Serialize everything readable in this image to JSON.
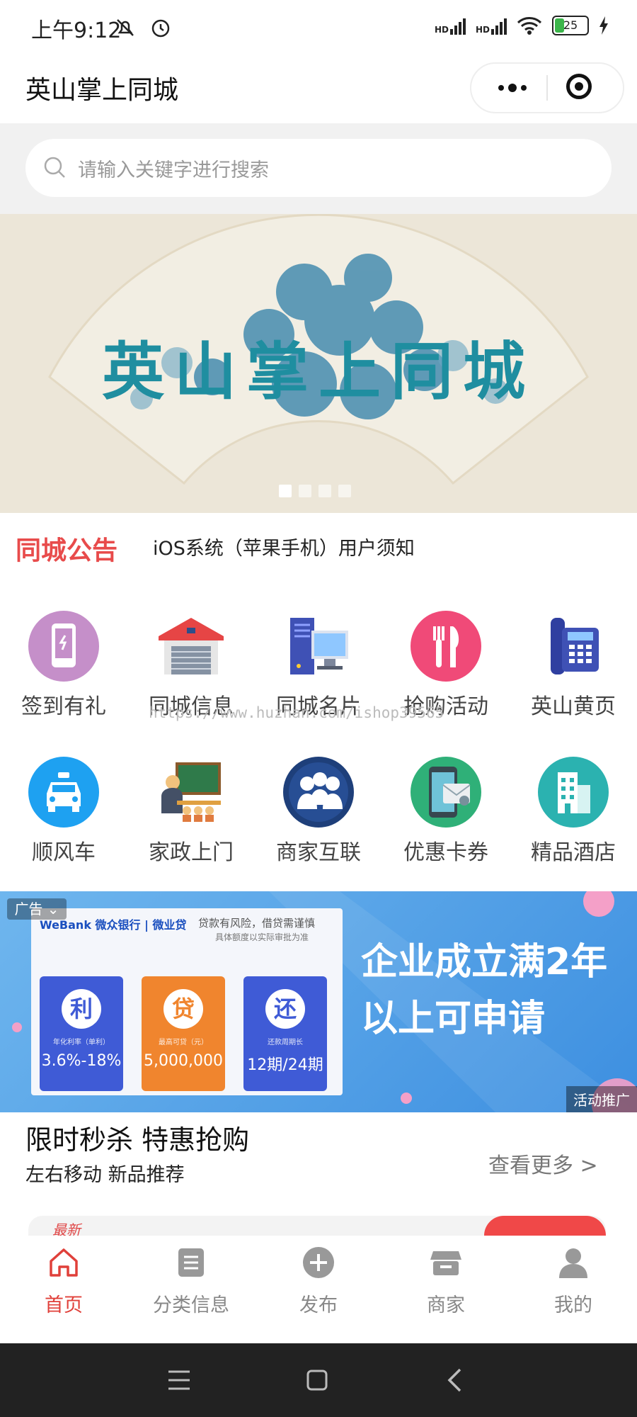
{
  "status_bar": {
    "time": "上午9:12",
    "network": "HD",
    "battery": "25"
  },
  "app": {
    "title": "英山掌上同城"
  },
  "search": {
    "placeholder": "请输入关键字进行搜索"
  },
  "banner": {
    "text": "英山掌上同城",
    "dots": 4,
    "active_dot": 1
  },
  "notice": {
    "title": "同城公告",
    "text": "iOS系统（苹果手机）用户须知"
  },
  "grid": [
    {
      "label": "签到有礼",
      "icon": "phone-icon",
      "color": "#c58fc9"
    },
    {
      "label": "同城信息",
      "icon": "garage-icon",
      "color": "#e64545"
    },
    {
      "label": "同城名片",
      "icon": "computer-icon",
      "color": "#3f51b5"
    },
    {
      "label": "抢购活动",
      "icon": "fork-knife-icon",
      "color": "#f04a78"
    },
    {
      "label": "英山黄页",
      "icon": "telephone-icon",
      "color": "#2f3fa0"
    },
    {
      "label": "顺风车",
      "icon": "taxi-icon",
      "color": "#1ea1f1"
    },
    {
      "label": "家政上门",
      "icon": "teacher-icon",
      "color": "#2f7a4a"
    },
    {
      "label": "商家互联",
      "icon": "people-icon",
      "color": "#1e3f7a"
    },
    {
      "label": "优惠卡券",
      "icon": "card-icon",
      "color": "#2fb078"
    },
    {
      "label": "精品酒店",
      "icon": "hotel-icon",
      "color": "#2bb2b0"
    }
  ],
  "watermark": "https://www.huzhan.com/ishop39565",
  "ad": {
    "tag": "广告",
    "brand": "WeBank 微众银行 | 微业贷",
    "risk": "贷款有风险，借贷需谨慎",
    "risk_sub": "具体额度以实际审批为准",
    "headline": "企业成立满2年以上可申请",
    "promo": "活动推广",
    "tiles": [
      {
        "char": "利",
        "sub": "年化利率（单利）",
        "value": "3.6%-18%",
        "color": "#3f5bd6"
      },
      {
        "char": "贷",
        "sub": "最高可贷（元）",
        "value": "5,000,000",
        "color": "#f0852e"
      },
      {
        "char": "还",
        "sub": "还款周期长",
        "value": "12期/24期",
        "color": "#3f5bd6"
      }
    ]
  },
  "flash_sale": {
    "title": "限时秒杀 特惠抢购",
    "subtitle": "左右移动 新品推荐",
    "more": "查看更多 >",
    "tag": "最新"
  },
  "tabs": [
    {
      "label": "首页",
      "icon": "home-icon",
      "active": true
    },
    {
      "label": "分类信息",
      "icon": "list-icon",
      "active": false
    },
    {
      "label": "发布",
      "icon": "plus-icon",
      "active": false
    },
    {
      "label": "商家",
      "icon": "store-icon",
      "active": false
    },
    {
      "label": "我的",
      "icon": "user-icon",
      "active": false
    }
  ],
  "colors": {
    "accent": "#e0403a",
    "notice": "#e84b4b"
  }
}
